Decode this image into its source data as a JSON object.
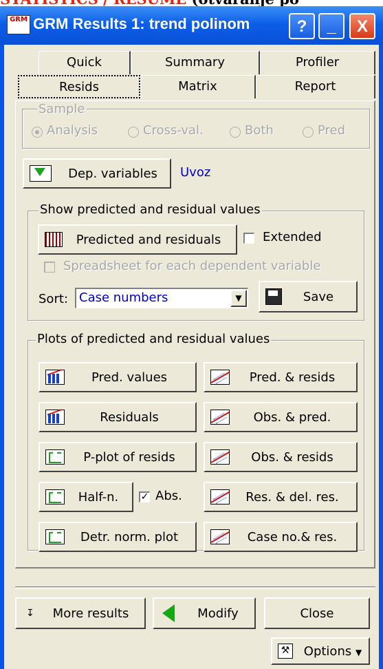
{
  "doc_header": {
    "text_red": "STATISTICS / RESUME",
    "text_black": "(otvaranje po"
  },
  "window": {
    "title": "GRM Results 1: trend polinom",
    "icon_label": "GRM",
    "help_label": "?",
    "minimize_label": "_",
    "close_label": "X"
  },
  "tabs": {
    "row1": [
      "Quick",
      "Summary",
      "Profiler"
    ],
    "row2": [
      "Resids",
      "Matrix",
      "Report"
    ],
    "active": "Resids"
  },
  "sample": {
    "label": "Sample",
    "options": [
      "Analysis",
      "Cross-val.",
      "Both",
      "Pred"
    ],
    "selected": "Analysis"
  },
  "dep": {
    "button_label": "Dep. variables",
    "value": "Uvoz"
  },
  "predicted": {
    "group_label": "Show predicted and residual values",
    "button_label": "Predicted and residuals",
    "extended_label": "Extended",
    "spreadsheet_label": "Spreadsheet for each dependent variable",
    "sort_label": "Sort:",
    "sort_value": "Case numbers",
    "save_label": "Save"
  },
  "plots": {
    "group_label": "Plots of predicted and residual values",
    "left": [
      "Pred. values",
      "Residuals",
      "P-plot of resids",
      "Half-n.",
      "Detr. norm. plot"
    ],
    "abs_label": "Abs.",
    "abs_checked": true,
    "right": [
      "Pred. & resids",
      "Obs. & pred.",
      "Obs. & resids",
      "Res. & del. res.",
      "Case no.& res."
    ]
  },
  "footer": {
    "more_label": "More results",
    "modify_label": "Modify",
    "close_label": "Close",
    "options_label": "Options"
  }
}
